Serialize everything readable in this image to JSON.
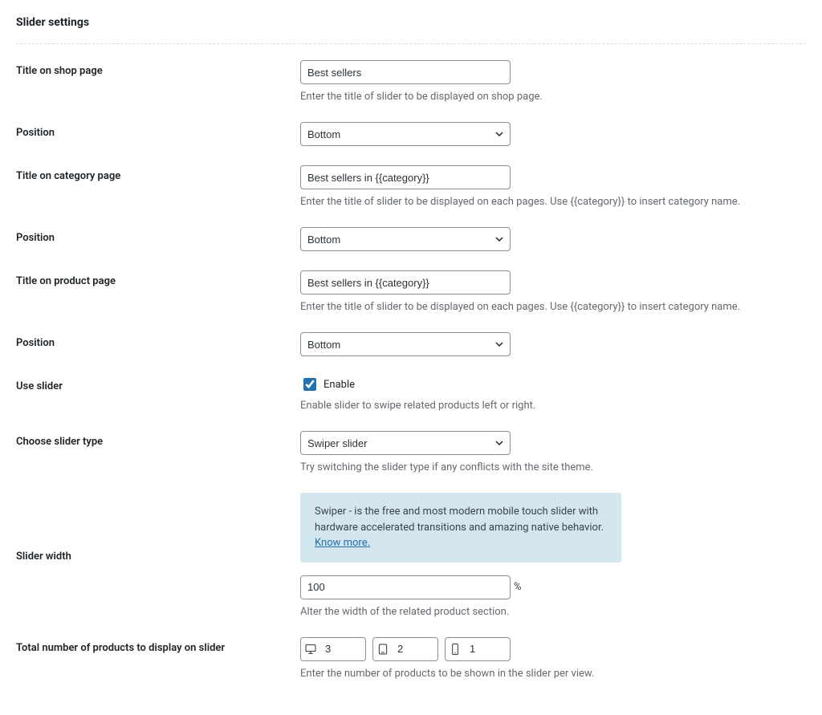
{
  "section_title": "Slider settings",
  "title_shop": {
    "label": "Title on shop page",
    "value": "Best sellers",
    "help": "Enter the title of slider to be displayed on shop page."
  },
  "position1": {
    "label": "Position",
    "value": "Bottom"
  },
  "title_category": {
    "label": "Title on category page",
    "value": "Best sellers in {{category}}",
    "help": "Enter the title of slider to be displayed on each pages. Use {{category}} to insert category name."
  },
  "position2": {
    "label": "Position",
    "value": "Bottom"
  },
  "title_product": {
    "label": "Title on product page",
    "value": "Best sellers in {{category}}",
    "help": "Enter the title of slider to be displayed on each pages. Use {{category}} to insert category name."
  },
  "position3": {
    "label": "Position",
    "value": "Bottom"
  },
  "use_slider": {
    "label": "Use slider",
    "checkbox_label": "Enable",
    "checked": true,
    "help": "Enable slider to swipe related products left or right."
  },
  "slider_type": {
    "label": "Choose slider type",
    "value": "Swiper slider",
    "help": "Try switching the slider type if any conflicts with the site theme."
  },
  "notice": {
    "text": "Swiper - is the free and most modern mobile touch slider with hardware accelerated transitions and amazing native behavior. ",
    "link_text": "Know more."
  },
  "slider_width": {
    "label": "Slider width",
    "value": "100",
    "suffix": "%",
    "help": "Alter the width of the related product section."
  },
  "total_products": {
    "label": "Total number of products to display on slider",
    "desktop": "3",
    "tablet": "2",
    "mobile": "1",
    "help": "Enter the number of products to be shown in the slider per view."
  }
}
